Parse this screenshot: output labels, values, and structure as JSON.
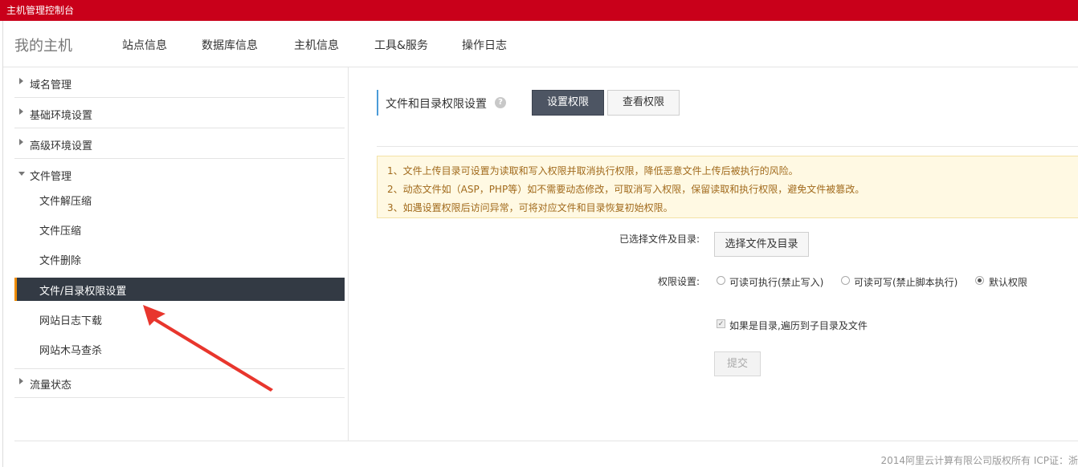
{
  "topbar": {
    "title": "主机管理控制台"
  },
  "navbar": {
    "brand": "我的主机",
    "items": [
      "站点信息",
      "数据库信息",
      "主机信息",
      "工具&服务",
      "操作日志"
    ]
  },
  "sidebar": {
    "groups": [
      {
        "label": "域名管理",
        "expanded": false
      },
      {
        "label": "基础环境设置",
        "expanded": false
      },
      {
        "label": "高级环境设置",
        "expanded": false
      },
      {
        "label": "文件管理",
        "expanded": true
      },
      {
        "label": "流量状态",
        "expanded": false
      }
    ],
    "file_items": [
      "文件解压缩",
      "文件压缩",
      "文件删除",
      "文件/目录权限设置",
      "网站日志下载",
      "网站木马查杀"
    ],
    "active_item": "文件/目录权限设置"
  },
  "main": {
    "section_title": "文件和目录权限设置",
    "help_icon": "?",
    "tab_set": "设置权限",
    "tab_view": "查看权限",
    "notice": [
      "1、文件上传目录可设置为读取和写入权限并取消执行权限，降低恶意文件上传后被执行的风险。",
      "2、动态文件如（ASP，PHP等）如不需要动态修改，可取消写入权限，保留读取和执行权限，避免文件被篡改。",
      "3、如遇设置权限后访问异常，可将对应文件和目录恢复初始权限。"
    ],
    "selected_label": "已选择文件及目录:",
    "select_button": "选择文件及目录",
    "perm_label": "权限设置:",
    "perm_options": [
      "可读可执行(禁止写入)",
      "可读可写(禁止脚本执行)",
      "默认权限"
    ],
    "perm_selected": "默认权限",
    "recursive_label": "如果是目录,遍历到子目录及文件",
    "recursive_checked": true,
    "submit": "提交"
  },
  "footer": {
    "text": "2014阿里云计算有限公司版权所有 ICP证：浙"
  },
  "annotation": {
    "color": "#e8362d"
  },
  "colors": {
    "brand_red": "#c9001a",
    "active_bg": "#333a44",
    "active_accent": "#f08c00",
    "tab_active": "#4d5563"
  }
}
